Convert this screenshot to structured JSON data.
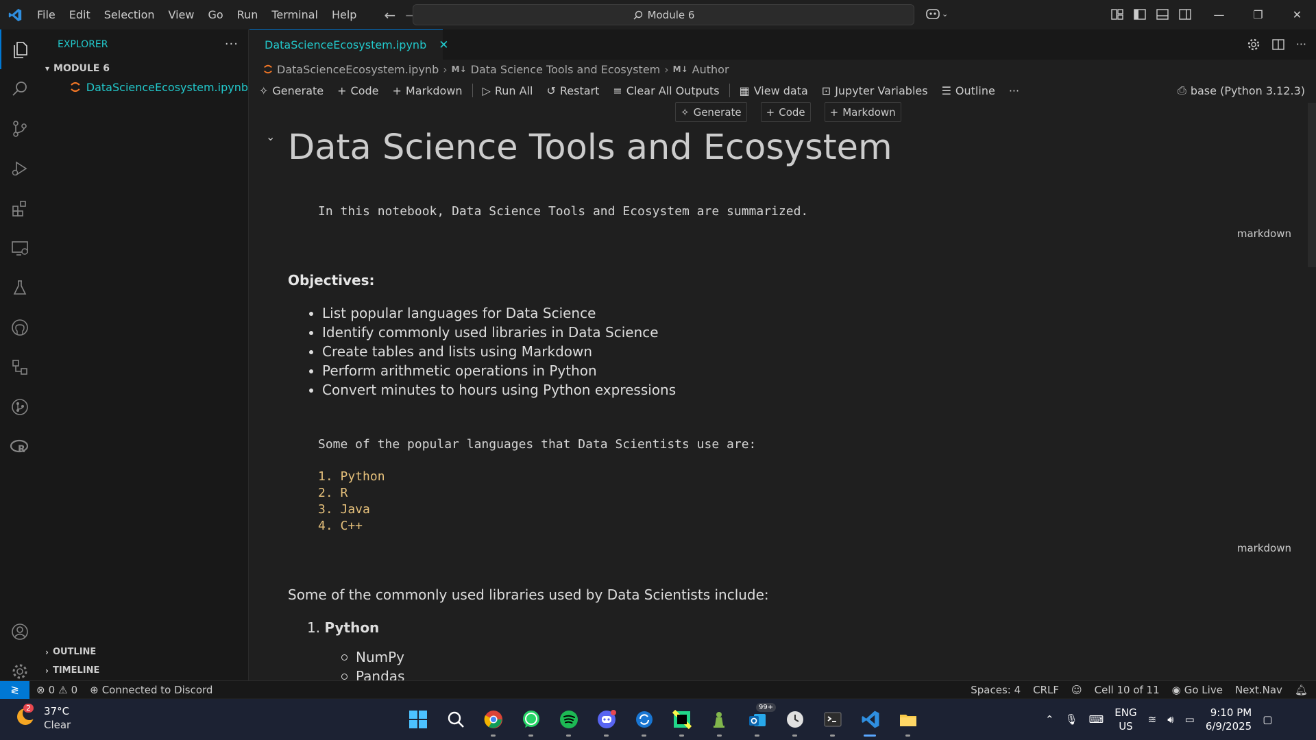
{
  "menu": [
    "File",
    "Edit",
    "Selection",
    "View",
    "Go",
    "Run",
    "Terminal",
    "Help"
  ],
  "command_center": "Module 6",
  "explorer": {
    "header": "EXPLORER",
    "folder": "MODULE 6",
    "file": "DataScienceEcosystem.ipynb",
    "outline": "OUTLINE",
    "timeline": "TIMELINE"
  },
  "tab": {
    "label": "DataScienceEcosystem.ipynb"
  },
  "breadcrumb": [
    "DataScienceEcosystem.ipynb",
    "Data Science Tools and Ecosystem",
    "Author"
  ],
  "breadcrumb_md": "M↓",
  "toolbar": {
    "generate": "Generate",
    "code": "Code",
    "markdown": "Markdown",
    "run_all": "Run All",
    "restart": "Restart",
    "clear_outputs": "Clear All Outputs",
    "view_data": "View data",
    "jupyter_variables": "Jupyter Variables",
    "outline": "Outline",
    "kernel": "base (Python 3.12.3)"
  },
  "insert_bar": {
    "generate": "Generate",
    "code": "Code",
    "markdown": "Markdown"
  },
  "notebook": {
    "title": "Data Science Tools and Ecosystem",
    "intro": "In this notebook, Data Science Tools and Ecosystem are summarized.",
    "cell_label_1": "markdown",
    "objectives_title": "Objectives:",
    "objectives": [
      "List popular languages for Data Science",
      "Identify commonly used libraries in Data Science",
      "Create tables and lists using Markdown",
      "Perform arithmetic operations in Python",
      "Convert minutes to hours using Python expressions"
    ],
    "languages_intro": "Some of the popular languages that Data Scientists use are:",
    "languages": [
      "1. Python",
      "2. R",
      "3. Java",
      "4. C++"
    ],
    "cell_label_2": "markdown",
    "libraries_intro": "Some of the commonly used libraries used by Data Scientists include:",
    "lib_number": "1.",
    "lib_group": "Python",
    "python_libs": [
      "NumPy",
      "Pandas"
    ]
  },
  "statusbar": {
    "errors": "0",
    "warnings": "0",
    "discord": "Connected to Discord",
    "spaces": "Spaces: 4",
    "eol": "CRLF",
    "cell": "Cell 10 of 11",
    "go_live": "Go Live",
    "next_nav": "Next.Nav"
  },
  "taskbar": {
    "weather_badge": "2",
    "temperature": "37°C",
    "condition": "Clear",
    "outlook_badge": "99+",
    "lang": "ENG",
    "region": "US",
    "time": "9:10 PM",
    "date": "6/9/2025"
  },
  "colors": {
    "accent": "#0078d4",
    "teal": "#22c9cc",
    "code_yellow": "#e5c07b"
  }
}
